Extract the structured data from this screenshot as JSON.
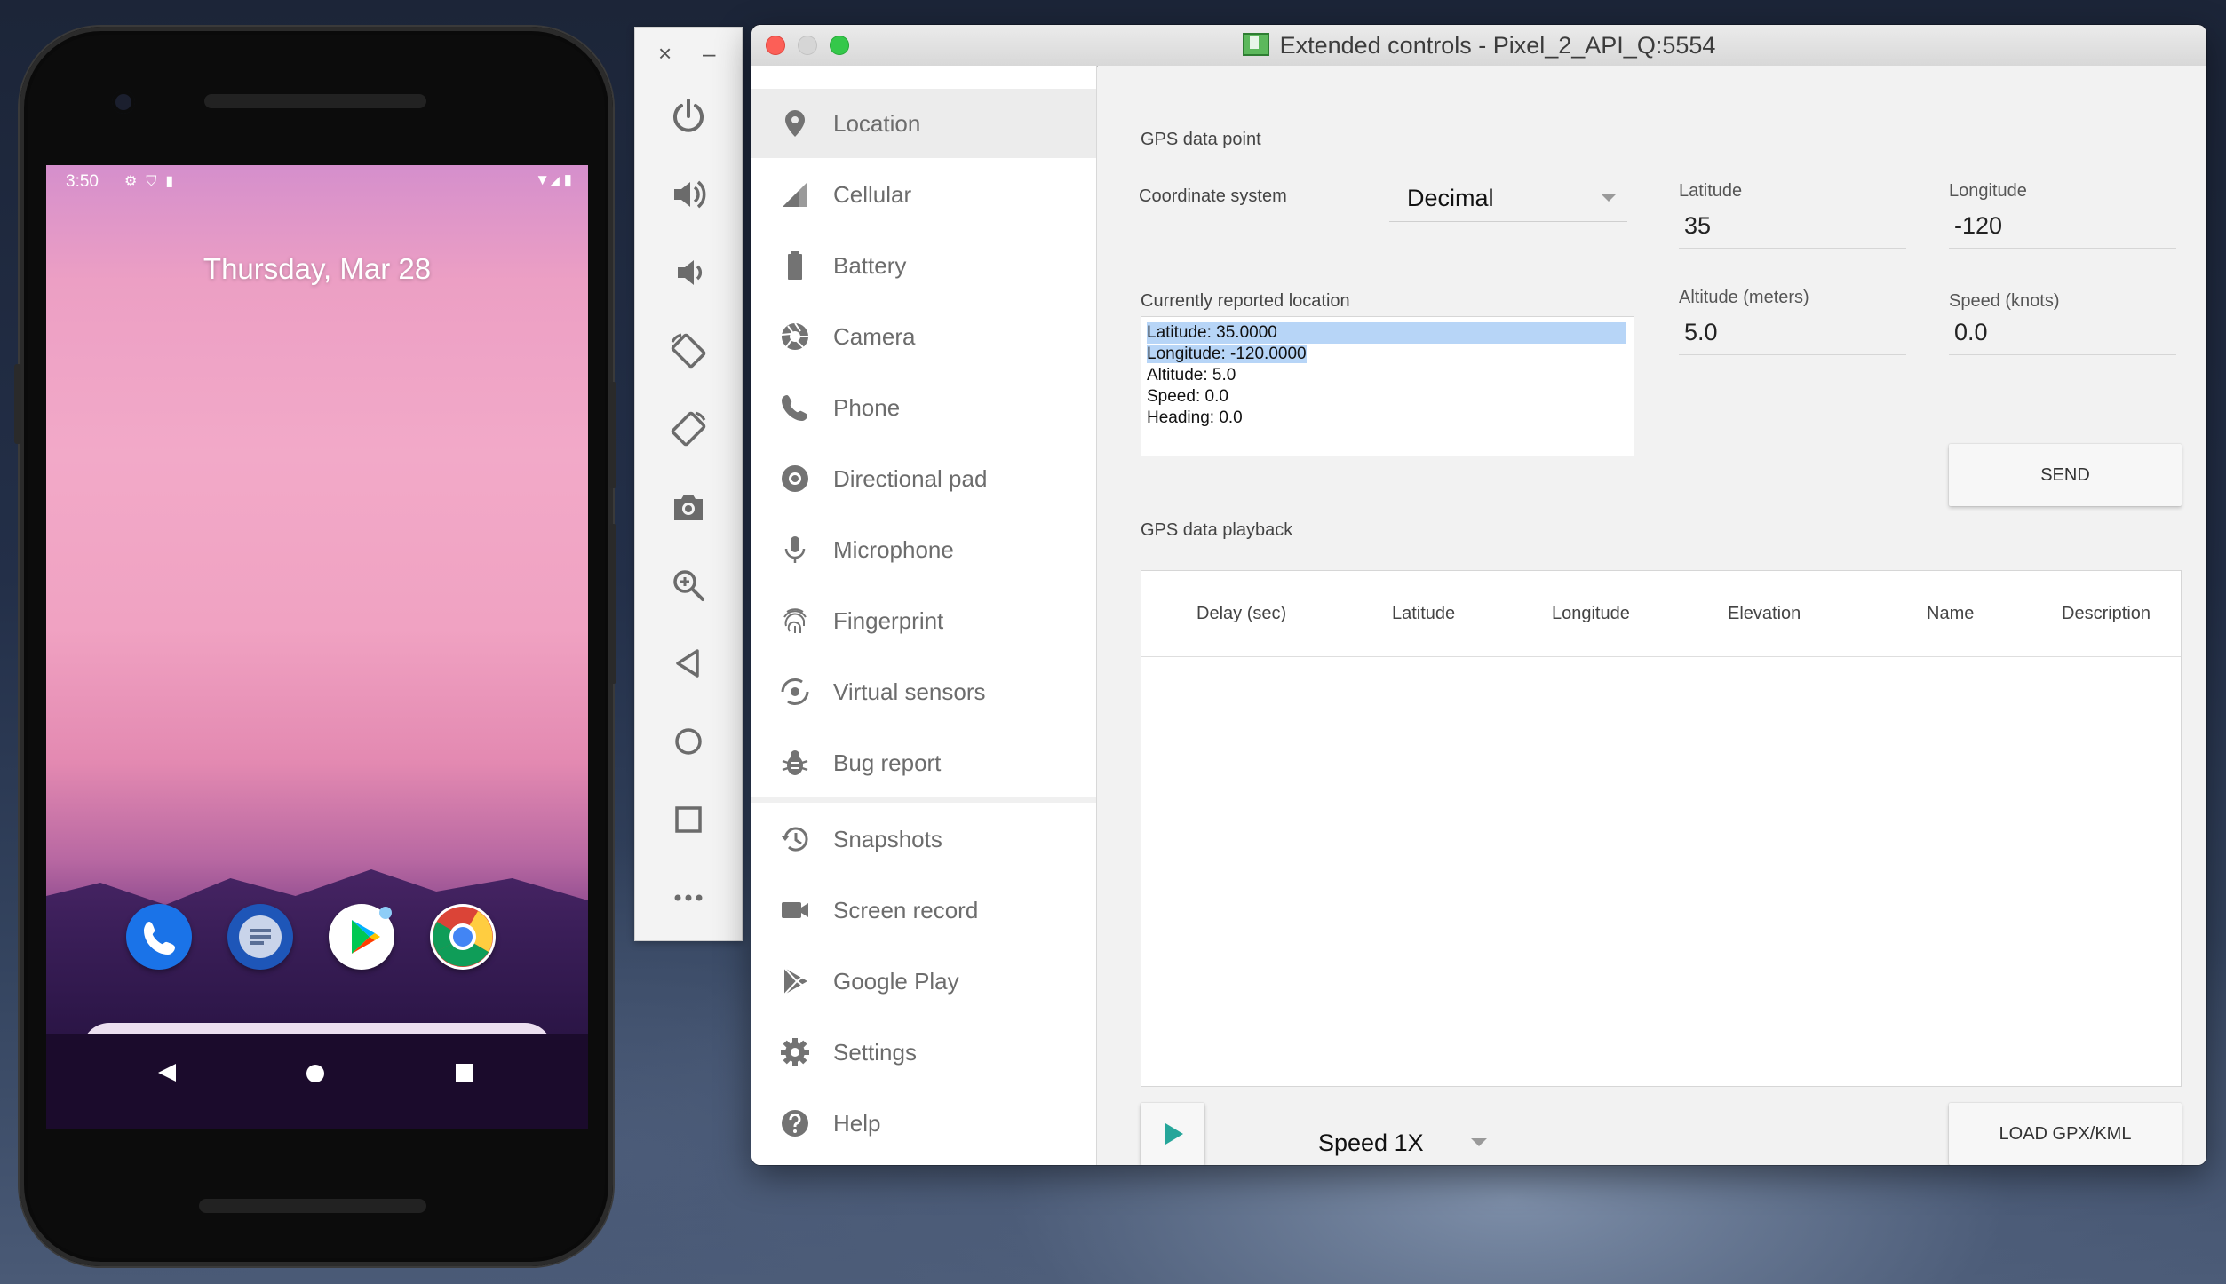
{
  "phone": {
    "time": "3:50",
    "date": "Thursday, Mar 28",
    "status_icons": [
      "gear-icon",
      "shield-icon",
      "sd-card-icon"
    ],
    "right_icons": [
      "wifi-icon",
      "signal-icon",
      "battery-icon"
    ],
    "dock_apps": [
      "Phone",
      "Messages",
      "Play Store",
      "Chrome"
    ]
  },
  "toolbar": {
    "buttons": [
      "power",
      "volume-up",
      "volume-down",
      "rotate-left",
      "rotate-right",
      "screenshot",
      "zoom",
      "back",
      "home",
      "overview",
      "more"
    ]
  },
  "window": {
    "title": "Extended controls - Pixel_2_API_Q:5554",
    "nav": [
      {
        "label": "Location",
        "icon": "location-pin-icon"
      },
      {
        "label": "Cellular",
        "icon": "cellular-icon"
      },
      {
        "label": "Battery",
        "icon": "battery-icon"
      },
      {
        "label": "Camera",
        "icon": "camera-icon"
      },
      {
        "label": "Phone",
        "icon": "phone-icon"
      },
      {
        "label": "Directional pad",
        "icon": "dpad-icon"
      },
      {
        "label": "Microphone",
        "icon": "microphone-icon"
      },
      {
        "label": "Fingerprint",
        "icon": "fingerprint-icon"
      },
      {
        "label": "Virtual sensors",
        "icon": "sensors-icon"
      },
      {
        "label": "Bug report",
        "icon": "bug-icon"
      },
      {
        "label": "Snapshots",
        "icon": "history-icon"
      },
      {
        "label": "Screen record",
        "icon": "videocam-icon"
      },
      {
        "label": "Google Play",
        "icon": "google-play-icon"
      },
      {
        "label": "Settings",
        "icon": "gear-icon"
      },
      {
        "label": "Help",
        "icon": "help-icon"
      }
    ]
  },
  "gps": {
    "section_title": "GPS data point",
    "coord_label": "Coordinate system",
    "coord_value": "Decimal",
    "latitude_label": "Latitude",
    "latitude_value": "35",
    "longitude_label": "Longitude",
    "longitude_value": "-120",
    "reported_label": "Currently reported location",
    "reported_lines": [
      "Latitude: 35.0000",
      "Longitude: -120.0000",
      "Altitude: 5.0",
      "Speed: 0.0",
      "Heading: 0.0"
    ],
    "altitude_label": "Altitude (meters)",
    "altitude_value": "5.0",
    "speed_label": "Speed (knots)",
    "speed_value": "0.0",
    "send_label": "SEND"
  },
  "playback": {
    "section_title": "GPS data playback",
    "columns": [
      "Delay (sec)",
      "Latitude",
      "Longitude",
      "Elevation",
      "Name",
      "Description"
    ],
    "speed_value": "Speed 1X",
    "load_label": "LOAD GPX/KML"
  },
  "colors": {
    "accent": "#26a69a",
    "nav_icon": "#737373",
    "selection": "#b7d5f7"
  }
}
